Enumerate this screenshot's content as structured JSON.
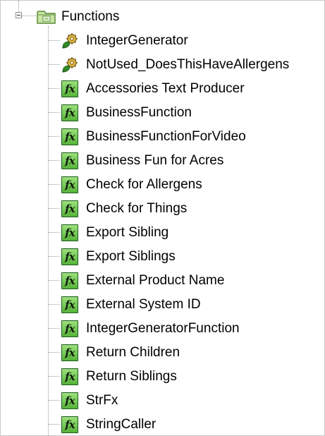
{
  "tree": {
    "root": {
      "label": "Functions",
      "expanded": true,
      "icon": "folder-icon"
    },
    "items": [
      {
        "label": "IntegerGenerator",
        "icon": "business-rule-icon"
      },
      {
        "label": "NotUsed_DoesThisHaveAllergens",
        "icon": "business-rule-icon"
      },
      {
        "label": "Accessories Text Producer",
        "icon": "function-icon"
      },
      {
        "label": "BusinessFunction",
        "icon": "function-icon"
      },
      {
        "label": "BusinessFunctionForVideo",
        "icon": "function-icon"
      },
      {
        "label": "Business Fun for Acres",
        "icon": "function-icon"
      },
      {
        "label": "Check for Allergens",
        "icon": "function-icon"
      },
      {
        "label": "Check for Things",
        "icon": "function-icon"
      },
      {
        "label": "Export Sibling",
        "icon": "function-icon"
      },
      {
        "label": "Export Siblings",
        "icon": "function-icon"
      },
      {
        "label": "External Product Name",
        "icon": "function-icon"
      },
      {
        "label": "External System ID",
        "icon": "function-icon"
      },
      {
        "label": "IntegerGeneratorFunction",
        "icon": "function-icon"
      },
      {
        "label": "Return Children",
        "icon": "function-icon"
      },
      {
        "label": "Return Siblings",
        "icon": "function-icon"
      },
      {
        "label": "StrFx",
        "icon": "function-icon"
      },
      {
        "label": "StringCaller",
        "icon": "function-icon"
      }
    ],
    "fx_glyph": "fx"
  },
  "colors": {
    "function_icon_fill": "#6cc24a",
    "function_icon_border": "#1f5a1f",
    "rule_icon_gear": "#e0b64a",
    "rule_icon_leaf": "#3a9a2a",
    "folder_fill": "#c9e6a5",
    "folder_border": "#5b8a3a"
  }
}
